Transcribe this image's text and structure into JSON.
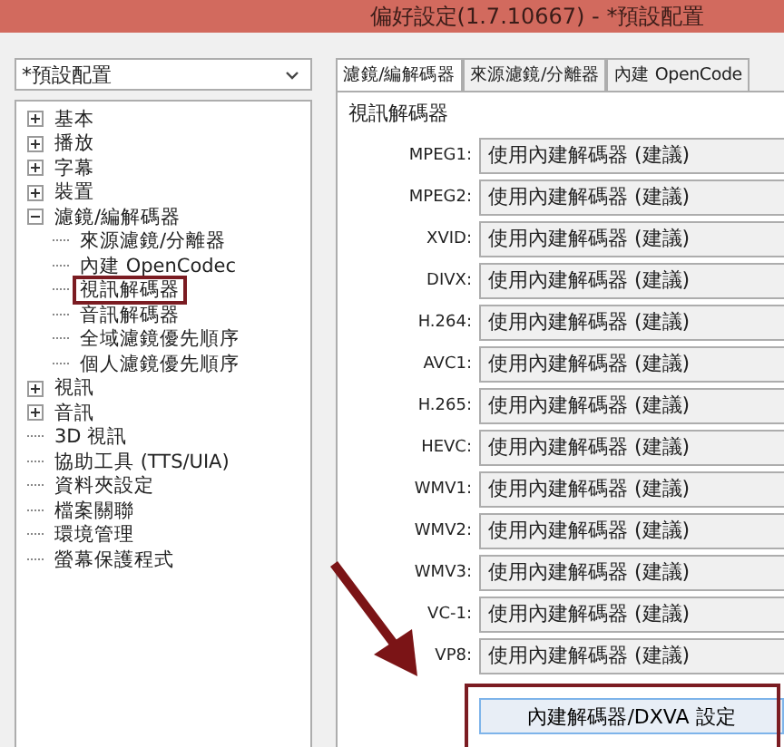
{
  "window": {
    "title": "偏好設定(1.7.10667) - *預設配置"
  },
  "profile_dropdown": {
    "value": "*預設配置"
  },
  "tree": [
    {
      "label": "基本",
      "expanded": false
    },
    {
      "label": "播放",
      "expanded": false
    },
    {
      "label": "字幕",
      "expanded": false
    },
    {
      "label": "裝置",
      "expanded": false
    },
    {
      "label": "濾鏡/編解碼器",
      "expanded": true,
      "children": [
        {
          "label": "來源濾鏡/分離器",
          "selected": false
        },
        {
          "label": "內建 OpenCodec",
          "selected": false
        },
        {
          "label": "視訊解碼器",
          "selected": true
        },
        {
          "label": "音訊解碼器",
          "selected": false
        },
        {
          "label": "全域濾鏡優先順序",
          "selected": false
        },
        {
          "label": "個人濾鏡優先順序",
          "selected": false
        }
      ]
    },
    {
      "label": "視訊",
      "expanded": false
    },
    {
      "label": "音訊",
      "expanded": false
    },
    {
      "label": "3D 視訊"
    },
    {
      "label": "協助工具 (TTS/UIA)"
    },
    {
      "label": "資料夾設定"
    },
    {
      "label": "檔案關聯"
    },
    {
      "label": "環境管理"
    },
    {
      "label": "螢幕保護程式"
    }
  ],
  "tabs": [
    {
      "label": "濾鏡/編解碼器",
      "selected": true
    },
    {
      "label": "來源濾鏡/分離器",
      "selected": false
    },
    {
      "label": "內建 OpenCode",
      "selected": false
    }
  ],
  "group": {
    "title": "視訊解碼器"
  },
  "decoders": [
    {
      "label": "MPEG1:",
      "value": "使用內建解碼器 (建議)"
    },
    {
      "label": "MPEG2:",
      "value": "使用內建解碼器 (建議)"
    },
    {
      "label": "XVID:",
      "value": "使用內建解碼器 (建議)"
    },
    {
      "label": "DIVX:",
      "value": "使用內建解碼器 (建議)"
    },
    {
      "label": "H.264:",
      "value": "使用內建解碼器 (建議)"
    },
    {
      "label": "AVC1:",
      "value": "使用內建解碼器 (建議)"
    },
    {
      "label": "H.265:",
      "value": "使用內建解碼器 (建議)"
    },
    {
      "label": "HEVC:",
      "value": "使用內建解碼器 (建議)"
    },
    {
      "label": "WMV1:",
      "value": "使用內建解碼器 (建議)"
    },
    {
      "label": "WMV2:",
      "value": "使用內建解碼器 (建議)"
    },
    {
      "label": "WMV3:",
      "value": "使用內建解碼器 (建議)"
    },
    {
      "label": "VC-1:",
      "value": "使用內建解碼器 (建議)"
    },
    {
      "label": "VP8:",
      "value": "使用內建解碼器 (建議)"
    }
  ],
  "settings_button": {
    "label": "內建解碼器/DXVA 設定",
    "highlighted": true
  }
}
